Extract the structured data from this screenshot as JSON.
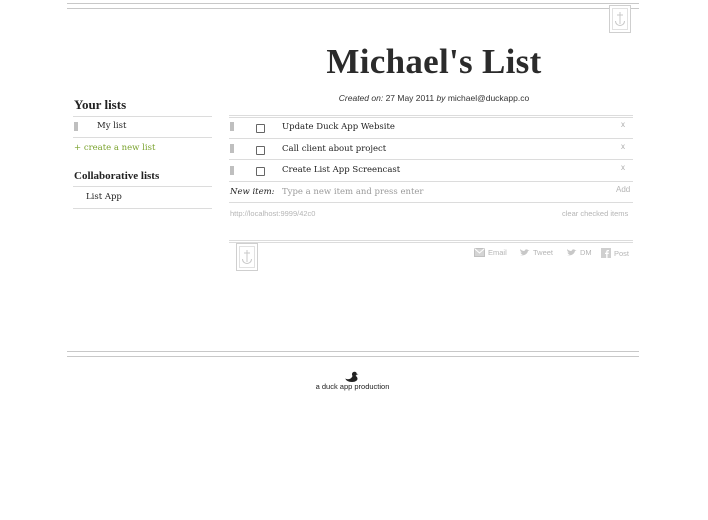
{
  "page": {
    "title": "Michael's List",
    "created_label": "Created on:",
    "created_date": "27 May 2011",
    "by_label": "by",
    "author_email": "michael@duckapp.co"
  },
  "sidebar": {
    "your_lists_heading": "Your lists",
    "your_lists": [
      {
        "label": "My list"
      }
    ],
    "create_link": "+ create a new list",
    "collab_heading": "Collaborative lists",
    "collab_lists": [
      {
        "label": "List App"
      }
    ]
  },
  "list": {
    "items": [
      {
        "label": "Update Duck App Website",
        "checked": false,
        "remove": "x"
      },
      {
        "label": "Call client about project",
        "checked": false,
        "remove": "x"
      },
      {
        "label": "Create List App Screencast",
        "checked": false,
        "remove": "x"
      }
    ],
    "new_item_label": "New item:",
    "new_item_placeholder": "Type a new item and press enter",
    "add_label": "Add",
    "url": "http://localhost:9999/42c0",
    "clear_label": "clear checked items"
  },
  "share": {
    "email": "Email",
    "tweet": "Tweet",
    "dm": "DM",
    "post": "Post"
  },
  "footer": {
    "text": "a duck app production"
  },
  "icons": {
    "top_badge": "anchor-icon",
    "bottom_badge": "anchor-icon",
    "email": "envelope-icon",
    "tweet": "bird-icon",
    "dm": "bird-icon",
    "post": "facebook-icon",
    "footer": "duck-icon"
  },
  "colors": {
    "accent_green": "#7aa32e",
    "muted_gray": "#b5b5b5"
  }
}
